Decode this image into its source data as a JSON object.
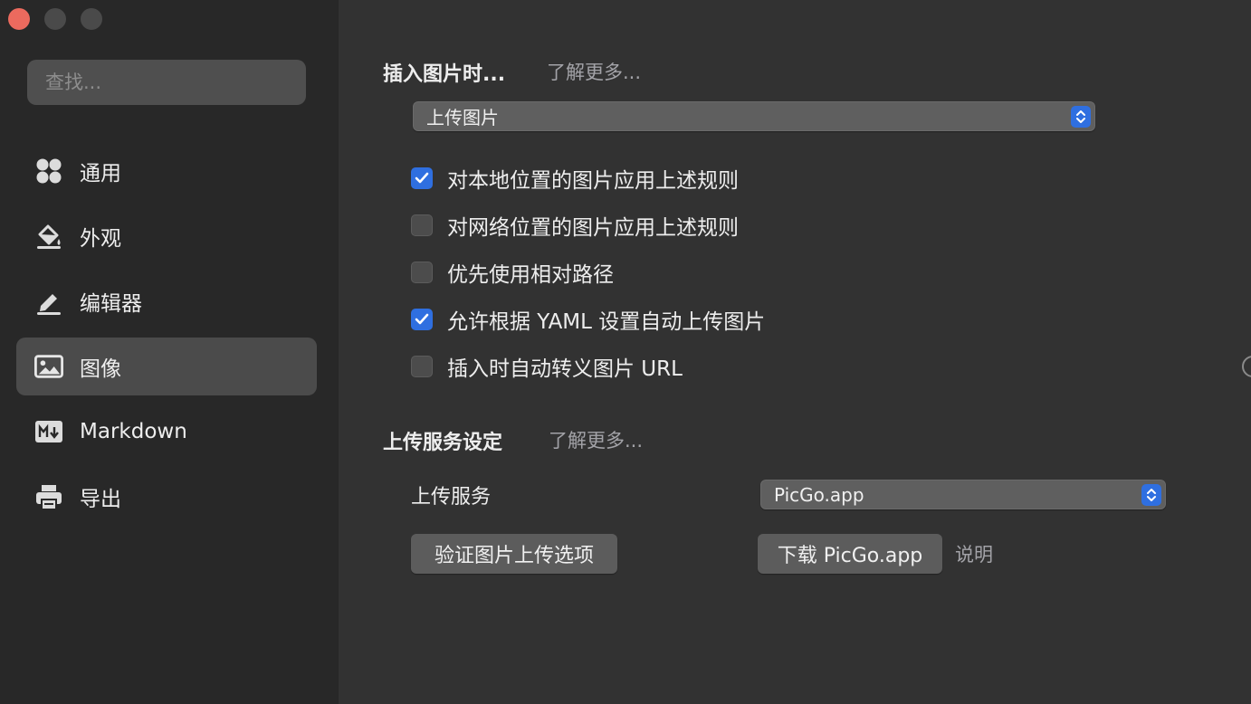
{
  "sidebar": {
    "search_placeholder": "查找...",
    "items": [
      {
        "label": "通用",
        "icon": "grid-icon"
      },
      {
        "label": "外观",
        "icon": "paint-bucket-icon"
      },
      {
        "label": "编辑器",
        "icon": "pencil-icon"
      },
      {
        "label": "图像",
        "icon": "image-icon",
        "active": true
      },
      {
        "label": "Markdown",
        "icon": "markdown-icon"
      },
      {
        "label": "导出",
        "icon": "printer-icon"
      }
    ]
  },
  "insert_section": {
    "title": "插入图片时...",
    "learn_more": "了解更多...",
    "action_select_value": "上传图片",
    "options": [
      {
        "label": "对本地位置的图片应用上述规则",
        "checked": true
      },
      {
        "label": "对网络位置的图片应用上述规则",
        "checked": false
      },
      {
        "label": "优先使用相对路径",
        "checked": false
      },
      {
        "label": "允许根据 YAML 设置自动上传图片",
        "checked": true
      },
      {
        "label": "插入时自动转义图片 URL",
        "checked": false
      }
    ]
  },
  "upload_section": {
    "title": "上传服务设定",
    "learn_more": "了解更多...",
    "service_label": "上传服务",
    "service_value": "PicGo.app",
    "verify_button": "验证图片上传选项",
    "download_button": "下载 PicGo.app",
    "help_link": "说明"
  },
  "colors": {
    "accent": "#2f6fe0",
    "close": "#ec6a5e",
    "sidebar_bg": "#282828",
    "main_bg": "#323232"
  }
}
